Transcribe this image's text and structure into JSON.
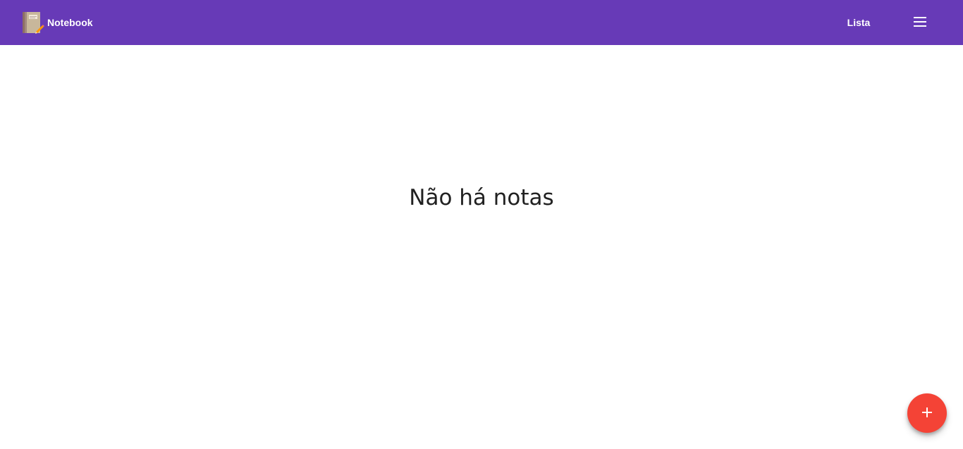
{
  "app": {
    "title": "Notebook",
    "logo_icon": "notebook-icon"
  },
  "toolbar": {
    "list_label": "Lista",
    "menu_icon": "menu-icon",
    "background_color": "#673ab7"
  },
  "main": {
    "empty_message": "Não há notas"
  },
  "fab": {
    "icon": "plus-icon",
    "color": "#f44336"
  }
}
